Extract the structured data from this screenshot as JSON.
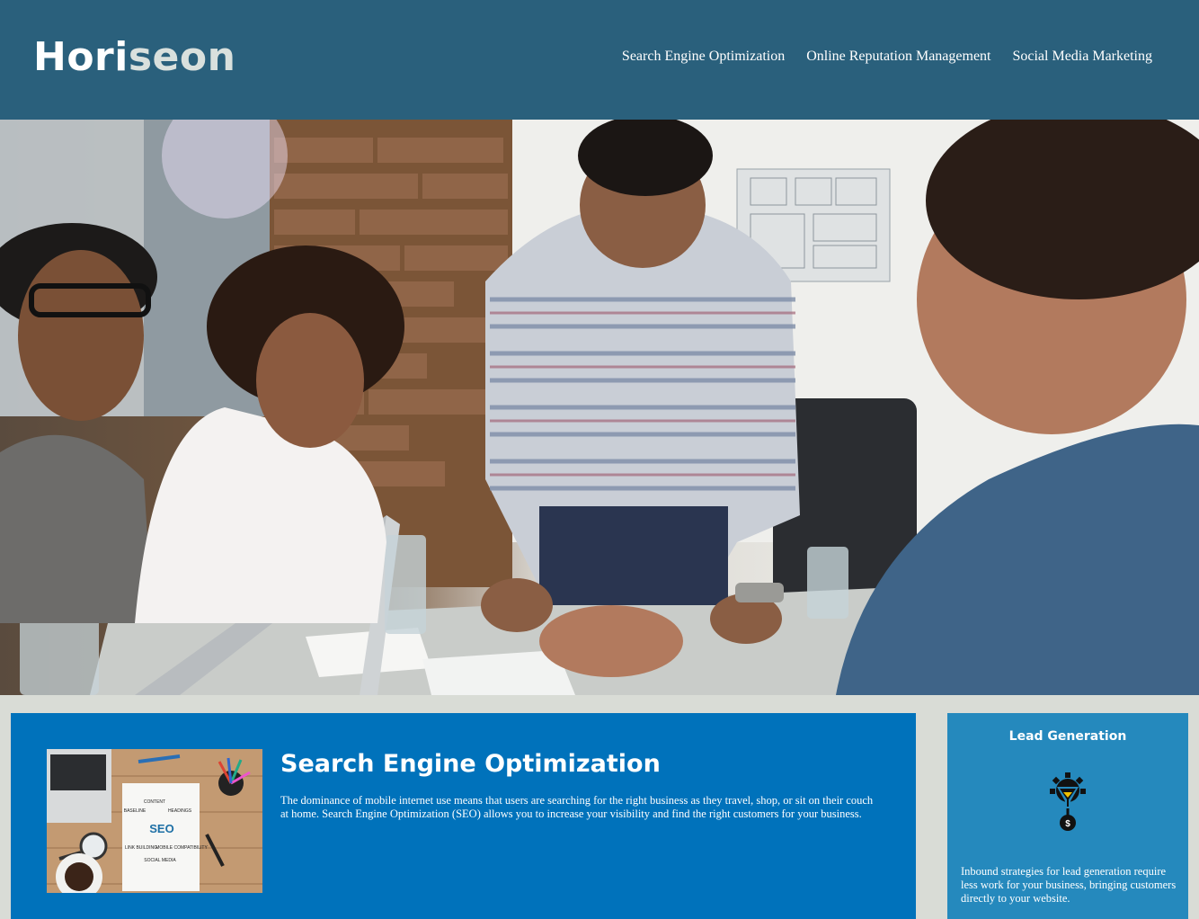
{
  "header": {
    "logo_part1": "Hori",
    "logo_part2": "seon",
    "nav": [
      {
        "label": "Search Engine Optimization"
      },
      {
        "label": "Online Reputation Management"
      },
      {
        "label": "Social Media Marketing"
      }
    ]
  },
  "hero": {
    "image": "team-meeting-photo"
  },
  "seo": {
    "image": "seo-desk-photo",
    "image_labels": [
      "CONTENT",
      "BASELINE",
      "HEADINGS",
      "SEO",
      "LINK BUILDING",
      "MOBILE COMPATIBILITY",
      "SOCIAL MEDIA"
    ],
    "title": "Search Engine Optimization",
    "text": "The dominance of mobile internet use means that users are searching for the right business as they travel, shop, or sit on their couch at home. Search Engine Optimization (SEO) allows you to increase your visibility and find the right customers for your business."
  },
  "lead": {
    "title": "Lead Generation",
    "icon": "lead-funnel-gear-icon",
    "text": "Inbound strategies for lead generation require less work for your business, bringing customers directly to your website."
  },
  "colors": {
    "header_bg": "#2a607c",
    "page_bg": "#d9dcd6",
    "seo_panel_bg": "#0072bb",
    "lead_panel_bg": "#2589bd"
  }
}
